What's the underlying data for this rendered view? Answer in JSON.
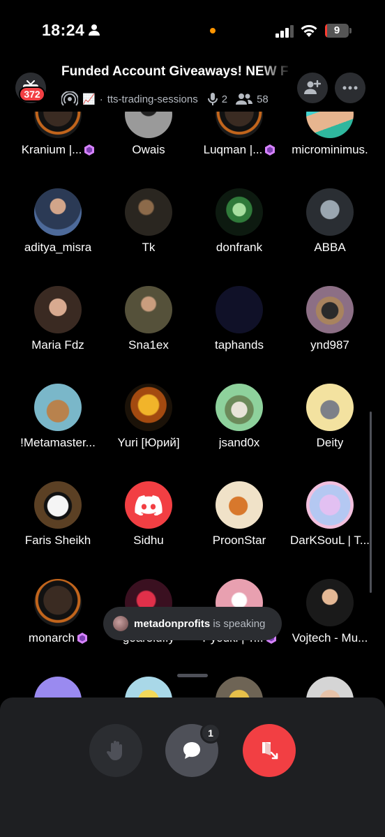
{
  "status_bar": {
    "time": "18:24",
    "battery_level": "9",
    "icons": [
      "person-icon",
      "signal-icon",
      "wifi-icon",
      "battery-icon"
    ],
    "battery_color": "#ff3b30"
  },
  "header": {
    "title": "Funded Account Giveaways! NEW F",
    "notification_badge": "372",
    "channel_emoji": "📈",
    "channel_name": "tts-trading-sessions",
    "speaker_count": "2",
    "listener_count": "58"
  },
  "participants": [
    {
      "name": "Kranium |...",
      "gem": true,
      "avatar": "dark-frame-portrait"
    },
    {
      "name": "Owais",
      "gem": false,
      "avatar": "gray-hat-figure"
    },
    {
      "name": "Luqman |...",
      "gem": true,
      "avatar": "dark-frame-portrait"
    },
    {
      "name": "microminimus.",
      "gem": false,
      "avatar": "teal-beach-photo"
    },
    {
      "name": "aditya_misra",
      "gem": false,
      "avatar": "suit-portrait"
    },
    {
      "name": "Tk",
      "gem": false,
      "avatar": "dark-photo"
    },
    {
      "name": "donfrank",
      "gem": false,
      "avatar": "green-character"
    },
    {
      "name": "ABBA",
      "gem": false,
      "avatar": "s-logo"
    },
    {
      "name": "Maria Fdz",
      "gem": false,
      "avatar": "woman-portrait"
    },
    {
      "name": "Sna1ex",
      "gem": false,
      "avatar": "soldier-portrait"
    },
    {
      "name": "taphands",
      "gem": false,
      "avatar": "empty-navy"
    },
    {
      "name": "ynd987",
      "gem": false,
      "avatar": "cowboy-portrait"
    },
    {
      "name": "!Metamaster...",
      "gem": false,
      "avatar": "cartoon-bear"
    },
    {
      "name": "Yuri [Юрий]",
      "gem": false,
      "avatar": "golden-bird"
    },
    {
      "name": "jsand0x",
      "gem": false,
      "avatar": "hat-character"
    },
    {
      "name": "Deity",
      "gem": false,
      "avatar": "pixel-character"
    },
    {
      "name": "Faris Sheikh",
      "gem": false,
      "avatar": "panda"
    },
    {
      "name": "Sidhu",
      "gem": false,
      "avatar": "discord-logo"
    },
    {
      "name": "ProonStar",
      "gem": false,
      "avatar": "squirrel"
    },
    {
      "name": "DarKSouL | T...",
      "gem": false,
      "avatar": "pastel-cloud"
    },
    {
      "name": "monarch",
      "gem": true,
      "avatar": "dark-frame-portrait"
    },
    {
      "name": "gear5luffy",
      "gem": false,
      "avatar": "red-anime"
    },
    {
      "name": "Pyouki | T...",
      "gem": true,
      "avatar": "pink-anime"
    },
    {
      "name": "Vojtech - Mu...",
      "gem": false,
      "avatar": "man-portrait"
    },
    {
      "name": "",
      "gem": false,
      "avatar": "purple-partial"
    },
    {
      "name": "",
      "gem": false,
      "avatar": "yellow-partial"
    },
    {
      "name": "",
      "gem": false,
      "avatar": "duck-partial"
    },
    {
      "name": "",
      "gem": false,
      "avatar": "face-partial"
    }
  ],
  "toast": {
    "speaker": "metadonprofits",
    "suffix": "is speaking"
  },
  "controls": {
    "chat_badge": "1",
    "icons": [
      "raise-hand-icon",
      "chat-bubble-icon",
      "leave-call-icon"
    ]
  },
  "colors": {
    "accent_red": "#f23f43",
    "gem_purple": "#d783ff",
    "panel_bg": "#1e1f22",
    "button_bg": "#2b2d31"
  }
}
